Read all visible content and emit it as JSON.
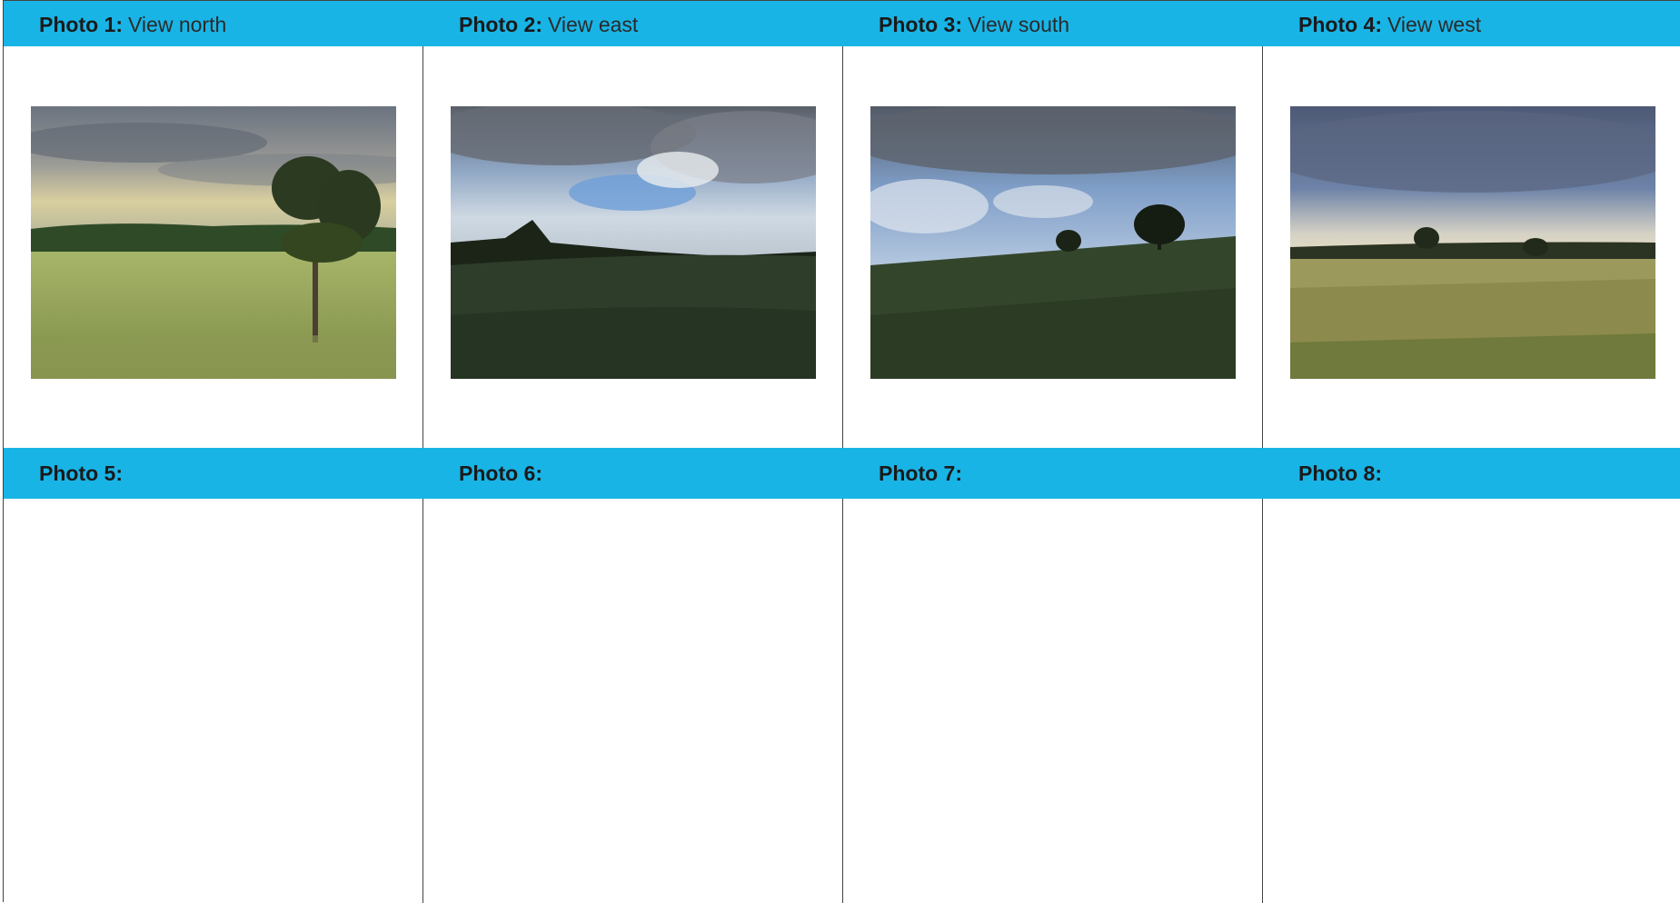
{
  "photos": [
    {
      "label": "Photo 1:",
      "caption": "View north",
      "image": "photo-north-landscape"
    },
    {
      "label": "Photo 2:",
      "caption": "View east",
      "image": "photo-east-landscape"
    },
    {
      "label": "Photo 3:",
      "caption": "View south",
      "image": "photo-south-landscape"
    },
    {
      "label": "Photo 4:",
      "caption": "View west",
      "image": "photo-west-landscape"
    },
    {
      "label": "Photo 5:",
      "caption": ""
    },
    {
      "label": "Photo 6:",
      "caption": ""
    },
    {
      "label": "Photo 7:",
      "caption": ""
    },
    {
      "label": "Photo 8:",
      "caption": ""
    }
  ],
  "colors": {
    "header": "#19b4e6",
    "grid_line": "#444444"
  }
}
